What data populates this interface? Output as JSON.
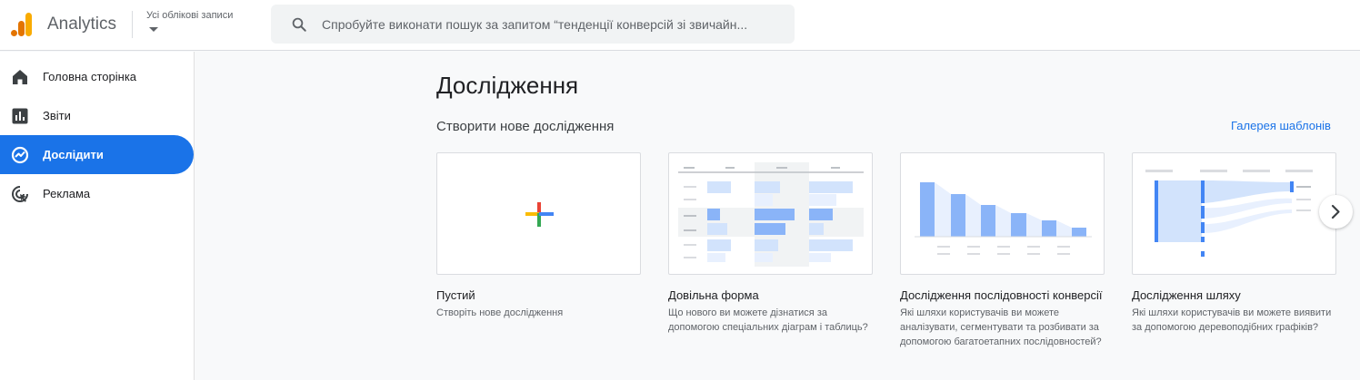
{
  "header": {
    "app_name": "Analytics",
    "account_selector": "Усі облікові записи",
    "search_placeholder": "Спробуйте виконати пошук за запитом “тенденції конверсій зі звичайн..."
  },
  "sidebar": {
    "items": [
      {
        "label": "Головна сторінка",
        "icon": "home-icon",
        "active": false
      },
      {
        "label": "Звіти",
        "icon": "bar-chart-icon",
        "active": false
      },
      {
        "label": "Дослідити",
        "icon": "explore-icon",
        "active": true
      },
      {
        "label": "Реклама",
        "icon": "advertising-icon",
        "active": false
      }
    ]
  },
  "main": {
    "title": "Дослідження",
    "section_title": "Створити нове дослідження",
    "gallery_link": "Галерея шаблонів",
    "cards": [
      {
        "title": "Пустий",
        "description": "Створіть нове дослідження"
      },
      {
        "title": "Довільна форма",
        "description": "Що нового ви можете дізнатися за допомогою спеціальних діаграм і таблиць?"
      },
      {
        "title": "Дослідження послідовності конверсії",
        "description": "Які шляхи користувачів ви можете аналізувати, сегментувати та розбивати за допомогою багатоетапних послідовностей?"
      },
      {
        "title": "Дослідження шляху",
        "description": "Які шляхи користувачів ви можете виявити за допомогою деревоподібних графіків?"
      }
    ]
  },
  "colors": {
    "accent": "#1a73e8",
    "logo_orange": "#f9ab00",
    "logo_dark_orange": "#e37400",
    "thumb_blue": "#8ab4f8",
    "thumb_light_blue": "#d2e3fc"
  }
}
